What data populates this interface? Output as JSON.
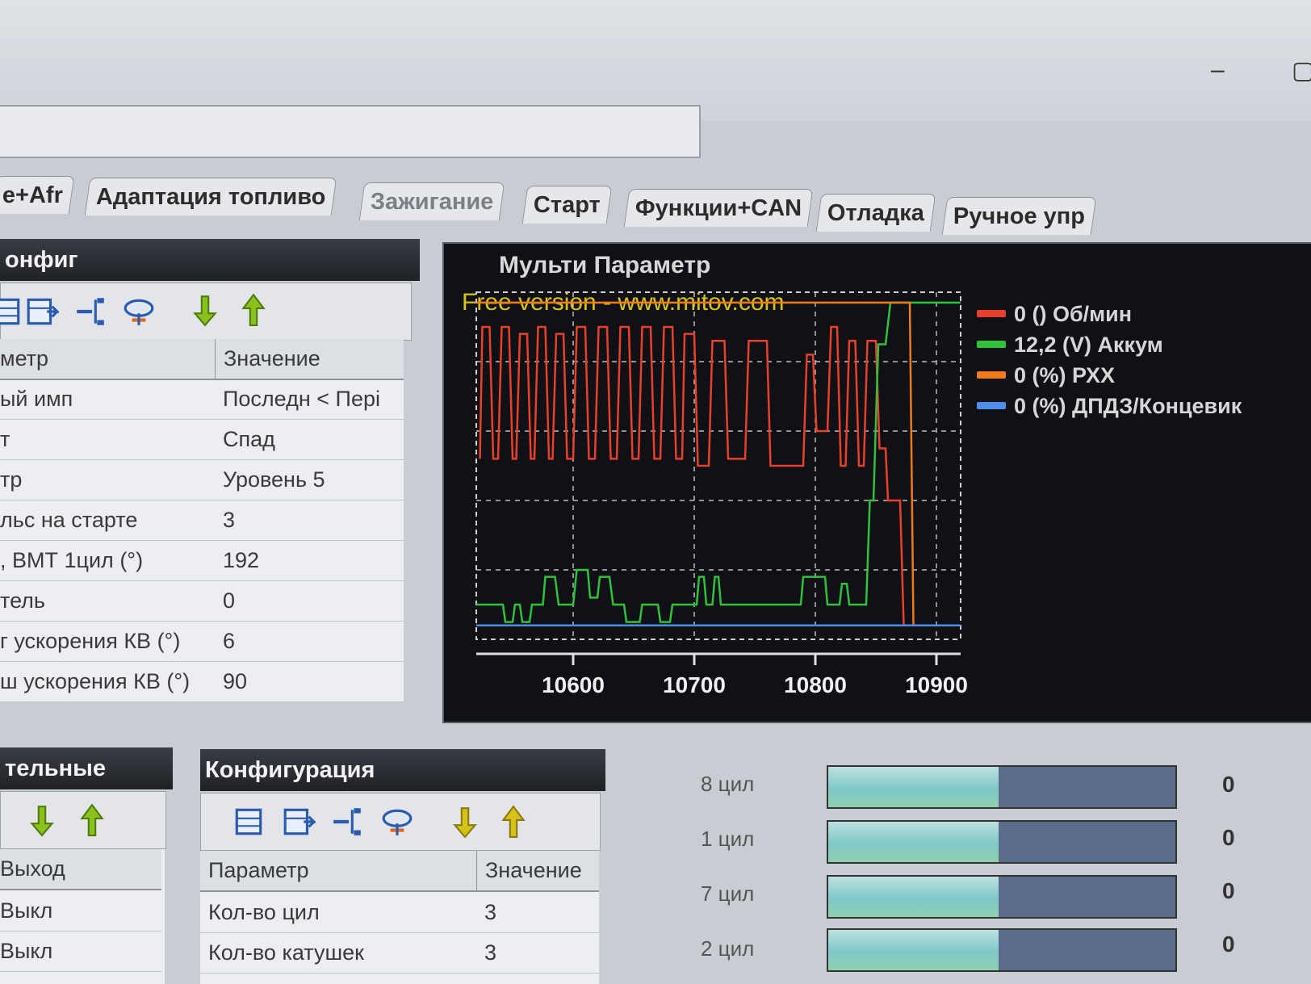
{
  "tabs": [
    "e+Afr",
    "Адаптация топливо",
    "Зажигание",
    "Старт",
    "Функции+CAN",
    "Отладка",
    "Ручное упр"
  ],
  "left_panel": {
    "title": "онфиг",
    "header": {
      "param": "метр",
      "value": "Значение"
    },
    "rows": [
      {
        "param": "ый имп",
        "value": "Последн < Пері"
      },
      {
        "param": "т",
        "value": "Спад"
      },
      {
        "param": "тр",
        "value": "Уровень 5"
      },
      {
        "param": "льс на старте",
        "value": "3"
      },
      {
        "param": ", ВМТ 1цил (°)",
        "value": "192"
      },
      {
        "param": "тель",
        "value": "0"
      },
      {
        "param": "г ускорения КВ (°)",
        "value": "6"
      },
      {
        "param": "ш ускорения КВ (°)",
        "value": "90"
      }
    ]
  },
  "bottom_left": {
    "title": "тельные",
    "header": "Выход",
    "rows": [
      "Выкл",
      "Выкл"
    ]
  },
  "config_panel": {
    "title": "Конфигурация",
    "header": {
      "param": "Параметр",
      "value": "Значение"
    },
    "rows": [
      {
        "param": "Кол-во цил",
        "value": "3"
      },
      {
        "param": "Кол-во катушек",
        "value": "3"
      }
    ]
  },
  "chart_panel": {
    "title": "Мульти Параметр",
    "watermark": "Free version - www.mitov.com"
  },
  "chart_data": {
    "type": "line",
    "x_ticks": [
      "10600",
      "10700",
      "10800",
      "10900"
    ],
    "xlim": [
      10520,
      10920
    ],
    "ylim": [
      0,
      1
    ],
    "grid": true,
    "legend_position": "right",
    "legend": [
      {
        "label": "0 () Об/мин",
        "color": "#e8402a"
      },
      {
        "label": "12,2 (V) Аккум",
        "color": "#2fc23a"
      },
      {
        "label": "0 (%) РХХ",
        "color": "#f07a1a"
      },
      {
        "label": "0 (%) ДПДЗ/Концевик",
        "color": "#4c8ee8"
      }
    ],
    "series": [
      {
        "name": "0 () Об/мин",
        "color": "#e8402a",
        "points": [
          [
            10523,
            0.52
          ],
          [
            10525,
            0.9
          ],
          [
            10531,
            0.9
          ],
          [
            10534,
            0.52
          ],
          [
            10538,
            0.52
          ],
          [
            10541,
            0.9
          ],
          [
            10547,
            0.9
          ],
          [
            10550,
            0.52
          ],
          [
            10553,
            0.52
          ],
          [
            10556,
            0.88
          ],
          [
            10562,
            0.88
          ],
          [
            10565,
            0.52
          ],
          [
            10568,
            0.52
          ],
          [
            10571,
            0.9
          ],
          [
            10577,
            0.9
          ],
          [
            10580,
            0.52
          ],
          [
            10583,
            0.52
          ],
          [
            10586,
            0.88
          ],
          [
            10592,
            0.88
          ],
          [
            10595,
            0.52
          ],
          [
            10600,
            0.52
          ],
          [
            10603,
            0.9
          ],
          [
            10610,
            0.9
          ],
          [
            10613,
            0.52
          ],
          [
            10618,
            0.52
          ],
          [
            10621,
            0.9
          ],
          [
            10628,
            0.9
          ],
          [
            10631,
            0.52
          ],
          [
            10636,
            0.52
          ],
          [
            10639,
            0.9
          ],
          [
            10646,
            0.9
          ],
          [
            10649,
            0.52
          ],
          [
            10654,
            0.52
          ],
          [
            10657,
            0.9
          ],
          [
            10664,
            0.9
          ],
          [
            10667,
            0.52
          ],
          [
            10672,
            0.52
          ],
          [
            10675,
            0.9
          ],
          [
            10682,
            0.9
          ],
          [
            10685,
            0.52
          ],
          [
            10690,
            0.52
          ],
          [
            10692,
            0.88
          ],
          [
            10700,
            0.88
          ],
          [
            10703,
            0.5
          ],
          [
            10712,
            0.5
          ],
          [
            10715,
            0.86
          ],
          [
            10725,
            0.86
          ],
          [
            10728,
            0.52
          ],
          [
            10742,
            0.52
          ],
          [
            10745,
            0.86
          ],
          [
            10760,
            0.86
          ],
          [
            10763,
            0.5
          ],
          [
            10790,
            0.5
          ],
          [
            10793,
            0.82
          ],
          [
            10798,
            0.82
          ],
          [
            10801,
            0.6
          ],
          [
            10810,
            0.6
          ],
          [
            10813,
            0.9
          ],
          [
            10818,
            0.9
          ],
          [
            10821,
            0.5
          ],
          [
            10825,
            0.5
          ],
          [
            10828,
            0.86
          ],
          [
            10833,
            0.86
          ],
          [
            10836,
            0.5
          ],
          [
            10840,
            0.5
          ],
          [
            10843,
            0.86
          ],
          [
            10850,
            0.86
          ],
          [
            10853,
            0.55
          ],
          [
            10858,
            0.55
          ],
          [
            10860,
            0.4
          ],
          [
            10870,
            0.4
          ],
          [
            10873,
            0.04
          ],
          [
            10880,
            0.04
          ]
        ]
      },
      {
        "name": "12,2 (V) Аккум",
        "color": "#2fc23a",
        "points": [
          [
            10520,
            0.1
          ],
          [
            10542,
            0.1
          ],
          [
            10544,
            0.05
          ],
          [
            10550,
            0.05
          ],
          [
            10552,
            0.1
          ],
          [
            10556,
            0.1
          ],
          [
            10558,
            0.05
          ],
          [
            10564,
            0.05
          ],
          [
            10566,
            0.1
          ],
          [
            10575,
            0.1
          ],
          [
            10577,
            0.18
          ],
          [
            10585,
            0.18
          ],
          [
            10588,
            0.1
          ],
          [
            10600,
            0.1
          ],
          [
            10603,
            0.2
          ],
          [
            10612,
            0.2
          ],
          [
            10614,
            0.12
          ],
          [
            10620,
            0.12
          ],
          [
            10622,
            0.18
          ],
          [
            10630,
            0.18
          ],
          [
            10633,
            0.1
          ],
          [
            10642,
            0.1
          ],
          [
            10644,
            0.05
          ],
          [
            10655,
            0.05
          ],
          [
            10657,
            0.1
          ],
          [
            10670,
            0.1
          ],
          [
            10672,
            0.05
          ],
          [
            10680,
            0.05
          ],
          [
            10682,
            0.1
          ],
          [
            10702,
            0.1
          ],
          [
            10704,
            0.18
          ],
          [
            10708,
            0.18
          ],
          [
            10710,
            0.1
          ],
          [
            10715,
            0.1
          ],
          [
            10717,
            0.18
          ],
          [
            10720,
            0.18
          ],
          [
            10722,
            0.1
          ],
          [
            10788,
            0.1
          ],
          [
            10790,
            0.18
          ],
          [
            10808,
            0.18
          ],
          [
            10810,
            0.1
          ],
          [
            10820,
            0.1
          ],
          [
            10822,
            0.16
          ],
          [
            10826,
            0.16
          ],
          [
            10828,
            0.1
          ],
          [
            10842,
            0.1
          ],
          [
            10845,
            0.4
          ],
          [
            10848,
            0.4
          ],
          [
            10852,
            0.85
          ],
          [
            10858,
            0.85
          ],
          [
            10862,
            0.97
          ],
          [
            10920,
            0.97
          ]
        ]
      },
      {
        "name": "0 (%) РХХ",
        "color": "#f07a1a",
        "points": [
          [
            10520,
            0.97
          ],
          [
            10878,
            0.97
          ],
          [
            10881,
            0.04
          ],
          [
            10885,
            0.04
          ]
        ]
      },
      {
        "name": "0 (%) ДПДЗ/Концевик",
        "color": "#4c8ee8",
        "points": [
          [
            10520,
            0.04
          ],
          [
            10920,
            0.04
          ]
        ]
      }
    ]
  },
  "cylinders": [
    {
      "label": "8 цил",
      "value": "0",
      "fill": 0.49
    },
    {
      "label": "1 цил",
      "value": "0",
      "fill": 0.49
    },
    {
      "label": "7 цил",
      "value": "0",
      "fill": 0.49
    },
    {
      "label": "2 цил",
      "value": "0",
      "fill": 0.49
    }
  ]
}
